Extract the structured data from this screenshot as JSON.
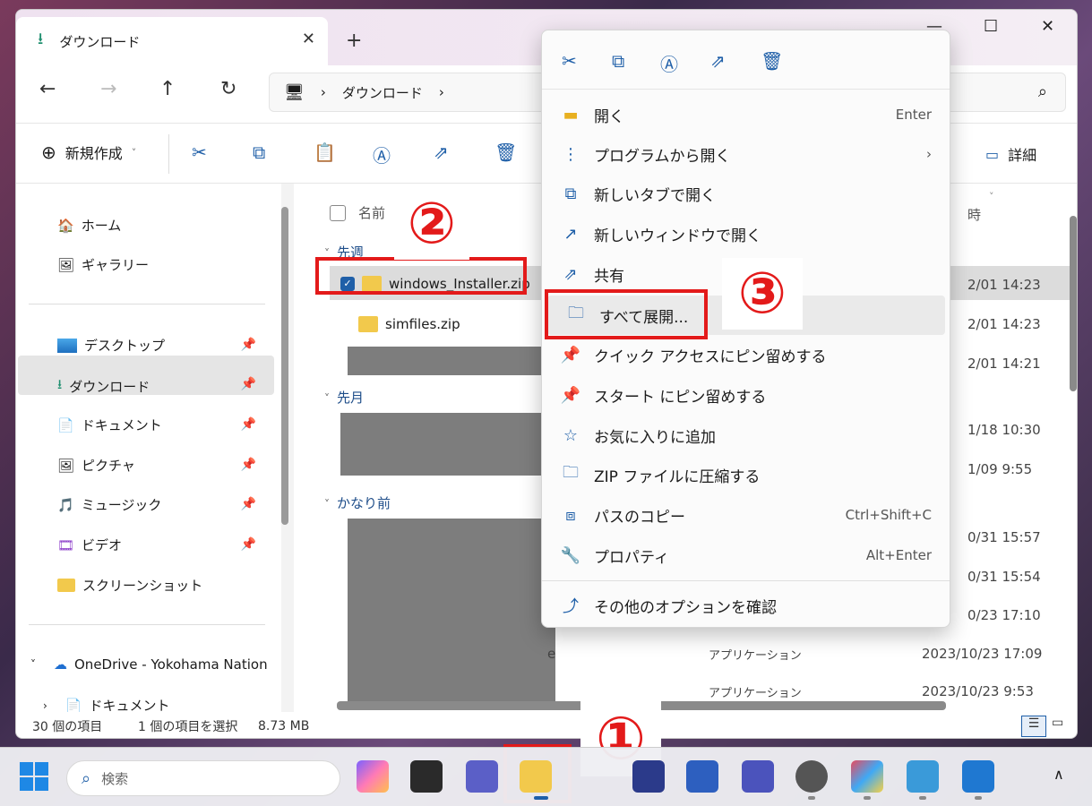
{
  "window": {
    "tab_title": "ダウンロード",
    "tab_close": "✕",
    "new_tab": "+",
    "controls": [
      "—",
      "☐",
      "✕"
    ]
  },
  "nav": {
    "back": "←",
    "forward": "→",
    "up": "↑",
    "refresh": "↻",
    "breadcrumb": [
      "ダウンロード"
    ],
    "sep": "›"
  },
  "toolbar": {
    "new_label": "新規作成",
    "detail_label": "詳細"
  },
  "sidebar": {
    "items": [
      {
        "label": "ホーム"
      },
      {
        "label": "ギャラリー"
      },
      {
        "label": "デスクトップ"
      },
      {
        "label": "ダウンロード"
      },
      {
        "label": "ドキュメント"
      },
      {
        "label": "ピクチャ"
      },
      {
        "label": "ミュージック"
      },
      {
        "label": "ビデオ"
      },
      {
        "label": "スクリーンショット"
      },
      {
        "label": "OneDrive - Yokohama Nation"
      },
      {
        "label": "ドキュメント"
      }
    ]
  },
  "files": {
    "col_name": "名前",
    "col_date": "時",
    "groups": [
      "先週",
      "先月",
      "かなり前"
    ],
    "rows": [
      {
        "name": "windows_Installer.zip",
        "date": "2/01 14:23"
      },
      {
        "name": "simfiles.zip",
        "date": "2/01 14:23"
      }
    ],
    "dates_other": [
      "2/01 14:21",
      "1/18 10:30",
      "1/09 9:55",
      "0/31 15:57",
      "0/31 15:54",
      "0/23 17:10"
    ],
    "row_type1": "アプリケーション",
    "row_date1": "2023/10/23 17:09",
    "row_type2": "アプリケーション",
    "row_date2": "2023/10/23 9:53",
    "row_name_tail": "e"
  },
  "status": {
    "count": "30 個の項目",
    "selected": "1 個の項目を選択",
    "size": "8.73 MB"
  },
  "context_menu": {
    "items": [
      {
        "label": "開く",
        "shortcut": "Enter"
      },
      {
        "label": "プログラムから開く",
        "shortcut": "›"
      },
      {
        "label": "新しいタブで開く",
        "shortcut": ""
      },
      {
        "label": "新しいウィンドウで開く",
        "shortcut": ""
      },
      {
        "label": "共有",
        "shortcut": ""
      },
      {
        "label": "すべて展開...",
        "shortcut": ""
      },
      {
        "label": "クイック アクセスにピン留めする",
        "shortcut": ""
      },
      {
        "label": "スタート にピン留めする",
        "shortcut": ""
      },
      {
        "label": "お気に入りに追加",
        "shortcut": ""
      },
      {
        "label": "ZIP ファイルに圧縮する",
        "shortcut": ""
      },
      {
        "label": "パスのコピー",
        "shortcut": "Ctrl+Shift+C"
      },
      {
        "label": "プロパティ",
        "shortcut": "Alt+Enter"
      },
      {
        "label": "その他のオプションを確認",
        "shortcut": ""
      }
    ]
  },
  "annotations": {
    "one": "①",
    "two": "②",
    "three": "③"
  },
  "taskbar": {
    "search_placeholder": "検索",
    "chevron": "∧"
  }
}
